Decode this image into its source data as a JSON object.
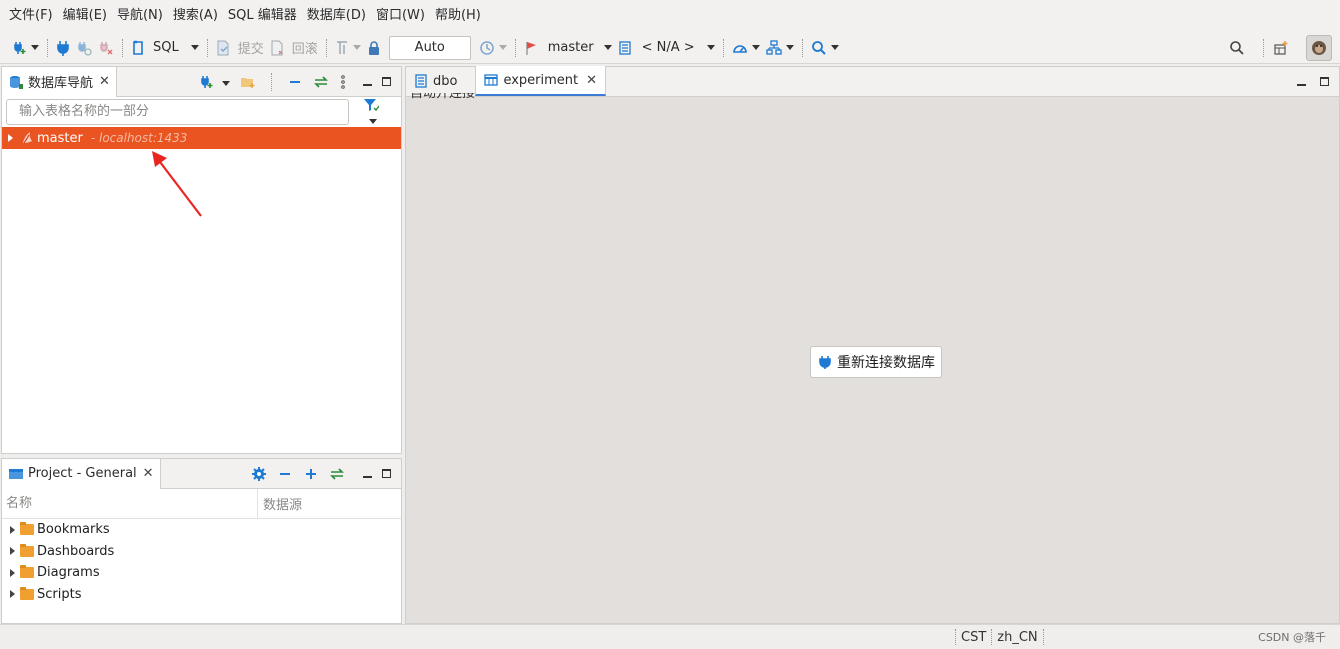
{
  "menubar": {
    "items": [
      "文件(F)",
      "编辑(E)",
      "导航(N)",
      "搜索(A)",
      "SQL 编辑器",
      "数据库(D)",
      "窗口(W)",
      "帮助(H)"
    ]
  },
  "toolbar": {
    "sql_label": "SQL",
    "commit_label": "提交",
    "rollback_label": "回滚",
    "transaction_mode": "Auto",
    "datasource_label": "master",
    "schema_label": "< N/A >"
  },
  "nav_panel": {
    "tab_title": "数据库导航",
    "filter_placeholder": "输入表格名称的一部分",
    "tree": [
      {
        "label": "master",
        "host": " - localhost:1433"
      }
    ]
  },
  "project_panel": {
    "tab_title": "Project - General",
    "columns": [
      "名称",
      "数据源"
    ],
    "items": [
      "Bookmarks",
      "Dashboards",
      "Diagrams",
      "Scripts"
    ]
  },
  "editor": {
    "tabs": [
      "dbo",
      "experiment"
    ],
    "active_tab": "experiment",
    "clipped_header": "自动开连接",
    "reconnect_label": "重新连接数据库"
  },
  "statusbar": {
    "timezone": "CST",
    "locale": "zh_CN",
    "watermark": "CSDN @落千"
  },
  "colors": {
    "selection": "#e95420",
    "accent_blue": "#1e7ad2",
    "editor_bg": "#e2dfdc",
    "annotation_arrow": "#e8261f"
  }
}
